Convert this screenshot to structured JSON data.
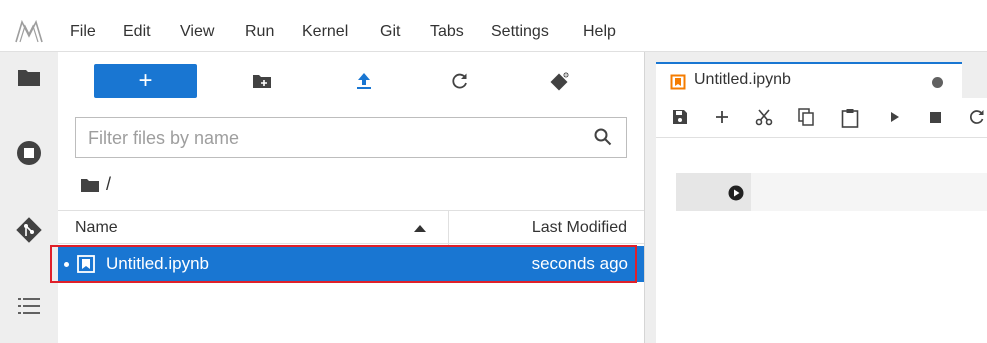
{
  "menu": {
    "items": [
      "File",
      "Edit",
      "View",
      "Run",
      "Kernel",
      "Git",
      "Tabs",
      "Settings",
      "Help"
    ]
  },
  "filebrowser": {
    "new_button_label": "+",
    "filter_placeholder": "Filter files by name",
    "breadcrumb": "/",
    "columns": {
      "name": "Name",
      "modified": "Last Modified"
    },
    "files": [
      {
        "name": "Untitled.ipynb",
        "modified": "seconds ago",
        "selected": true
      }
    ]
  },
  "notebook": {
    "tab_label": "Untitled.ipynb"
  },
  "colors": {
    "accent": "#1976d2",
    "highlight": "#e0202a",
    "notebook_icon": "#f57c00"
  },
  "icons": {
    "activity": [
      "folder-icon",
      "running-icon",
      "git-icon",
      "table-of-contents-icon"
    ],
    "toolbar": [
      "new-folder-icon",
      "upload-icon",
      "refresh-icon",
      "git-clone-icon"
    ],
    "notebook_toolbar": [
      "save-icon",
      "add-cell-icon",
      "cut-icon",
      "copy-icon",
      "paste-icon",
      "run-icon",
      "stop-icon",
      "restart-icon"
    ]
  }
}
